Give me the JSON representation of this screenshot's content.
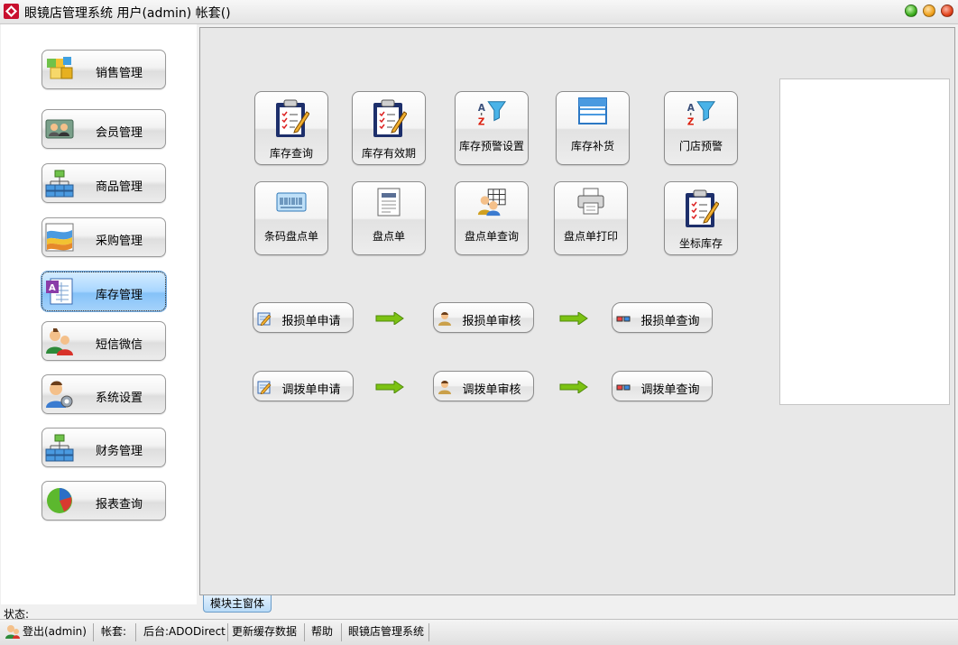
{
  "window": {
    "title": "眼镜店管理系统 用户(admin) 帐套()"
  },
  "sidebar": {
    "items": [
      {
        "label": "销售管理",
        "icon": "cubes-icon",
        "active": false
      },
      {
        "label": "会员管理",
        "icon": "members-card-icon",
        "active": false
      },
      {
        "label": "商品管理",
        "icon": "org-chart-icon",
        "active": false
      },
      {
        "label": "采购管理",
        "icon": "purchase-chart-icon",
        "active": false
      },
      {
        "label": "库存管理",
        "icon": "inventory-form-icon",
        "active": true
      },
      {
        "label": "短信微信",
        "icon": "users-message-icon",
        "active": false
      },
      {
        "label": "系统设置",
        "icon": "user-settings-icon",
        "active": false
      },
      {
        "label": "财务管理",
        "icon": "org-chart-icon",
        "active": false
      },
      {
        "label": "报表查询",
        "icon": "pie-chart-icon",
        "active": false
      }
    ]
  },
  "modules": [
    {
      "label": "库存查询",
      "icon": "clipboard-pencil-icon"
    },
    {
      "label": "库存有效期",
      "icon": "clipboard-pencil-icon"
    },
    {
      "label": "库存预警设置",
      "icon": "sort-filter-icon"
    },
    {
      "label": "库存补货",
      "icon": "list-window-icon"
    },
    {
      "label": "门店预警",
      "icon": "sort-filter-icon"
    },
    {
      "label": "条码盘点单",
      "icon": "barcode-card-icon"
    },
    {
      "label": "盘点单",
      "icon": "document-icon"
    },
    {
      "label": "盘点单查询",
      "icon": "people-grid-icon"
    },
    {
      "label": "盘点单打印",
      "icon": "printer-icon"
    },
    {
      "label": "坐标库存",
      "icon": "clipboard-pencil-icon"
    }
  ],
  "flows": {
    "loss": {
      "apply": "报损单申请",
      "review": "报损单审核",
      "query": "报损单查询"
    },
    "transfer": {
      "apply": "调拨单申请",
      "review": "调拨单审核",
      "query": "调拨单查询"
    }
  },
  "tabs": {
    "main": "模块主窗体"
  },
  "status": {
    "label": "状态:",
    "logout": "登出(admin)",
    "account": "帐套:",
    "backend": "后台:ADODirect",
    "refresh": "更新缓存数据",
    "help": "帮助",
    "system": "眼镜店管理系统"
  },
  "colors": {
    "accent": "#a8d6ff",
    "arrow": "#7cc213"
  }
}
